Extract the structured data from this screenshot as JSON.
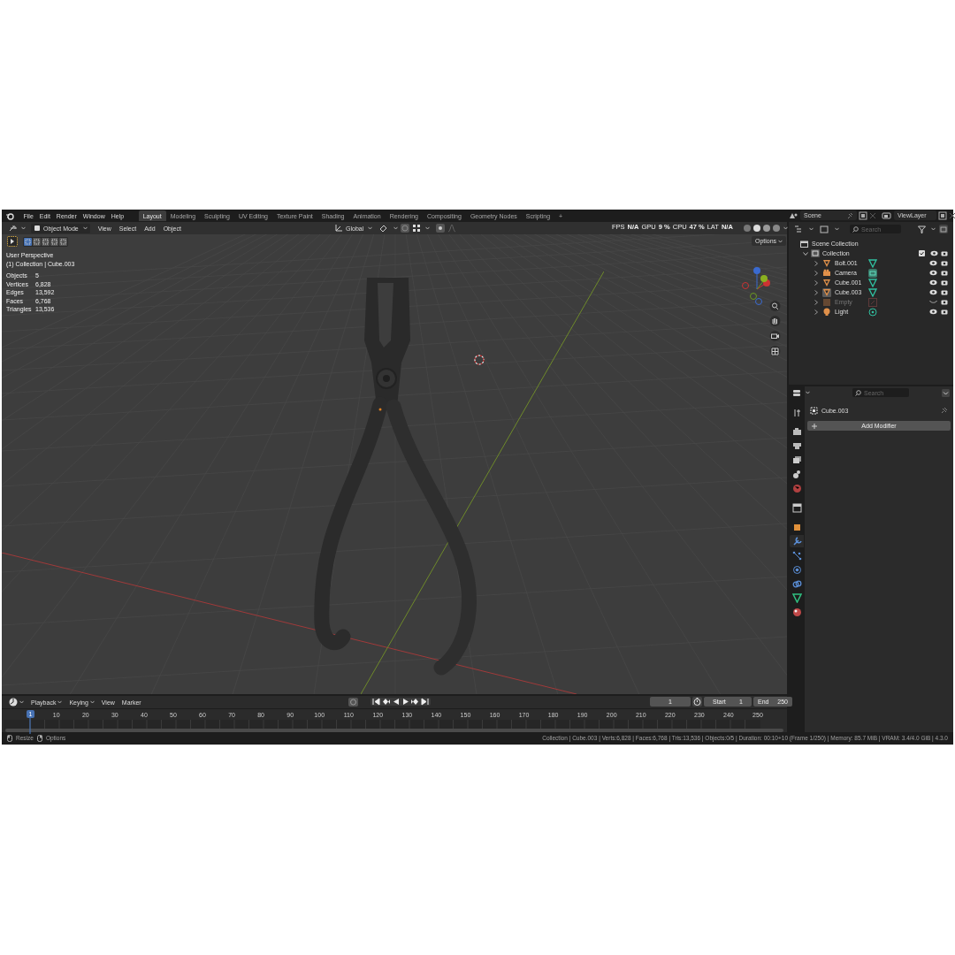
{
  "menu": [
    "File",
    "Edit",
    "Render",
    "Window",
    "Help"
  ],
  "workspace_tabs": [
    {
      "label": "Layout",
      "selected": true
    },
    {
      "label": "Modeling",
      "selected": false
    },
    {
      "label": "Sculpting",
      "selected": false
    },
    {
      "label": "UV Editing",
      "selected": false
    },
    {
      "label": "Texture Paint",
      "selected": false
    },
    {
      "label": "Shading",
      "selected": false
    },
    {
      "label": "Animation",
      "selected": false
    },
    {
      "label": "Rendering",
      "selected": false
    },
    {
      "label": "Compositing",
      "selected": false
    },
    {
      "label": "Geometry Nodes",
      "selected": false
    },
    {
      "label": "Scripting",
      "selected": false
    },
    {
      "label": "+",
      "selected": false
    }
  ],
  "scene": "Scene",
  "view_layer": "ViewLayer",
  "viewport_header": {
    "mode": "Object Mode",
    "menus": [
      "View",
      "Select",
      "Add",
      "Object"
    ],
    "orientation": "Global",
    "options": "Options"
  },
  "performance": [
    {
      "label": "FPS",
      "value": "N/A"
    },
    {
      "label": "GPU",
      "value": "9 %"
    },
    {
      "label": "CPU",
      "value": "47 %"
    },
    {
      "label": "LAT",
      "value": "N/A"
    }
  ],
  "viewport_info": {
    "view": "User Perspective",
    "context": "(1) Collection | Cube.003",
    "stats": [
      {
        "label": "Objects",
        "value": "5"
      },
      {
        "label": "Vertices",
        "value": "6,828"
      },
      {
        "label": "Edges",
        "value": "13,592"
      },
      {
        "label": "Faces",
        "value": "6,768"
      },
      {
        "label": "Triangles",
        "value": "13,536"
      }
    ]
  },
  "outliner": {
    "search_placeholder": "Search",
    "root": "Scene Collection",
    "collection": {
      "name": "Collection",
      "expanded": true,
      "checked": true
    },
    "items": [
      {
        "name": "Bolt.001",
        "kind": "mesh",
        "active": false,
        "visible": true
      },
      {
        "name": "Camera",
        "kind": "camera",
        "active": false,
        "visible": true
      },
      {
        "name": "Cube.001",
        "kind": "mesh",
        "active": false,
        "visible": true
      },
      {
        "name": "Cube.003",
        "kind": "mesh",
        "active": true,
        "visible": true
      },
      {
        "name": "Empty",
        "kind": "empty",
        "active": false,
        "visible": false
      },
      {
        "name": "Light",
        "kind": "light",
        "active": false,
        "visible": true
      }
    ]
  },
  "properties": {
    "search_placeholder": "Search",
    "object": "Cube.003",
    "add_button": "Add Modifier",
    "tabs": [
      {
        "kind": "tool",
        "selected": false
      },
      {
        "kind": "render",
        "selected": false
      },
      {
        "kind": "output",
        "selected": false
      },
      {
        "kind": "view_layer",
        "selected": false
      },
      {
        "kind": "scene",
        "selected": false
      },
      {
        "kind": "world",
        "selected": false
      },
      {
        "kind": "collection",
        "selected": false
      },
      {
        "kind": "object",
        "selected": false
      },
      {
        "kind": "modifiers",
        "selected": true
      },
      {
        "kind": "particles",
        "selected": false
      },
      {
        "kind": "physics",
        "selected": false
      },
      {
        "kind": "constraints",
        "selected": false
      },
      {
        "kind": "data",
        "selected": false
      },
      {
        "kind": "material",
        "selected": false
      }
    ]
  },
  "timeline": {
    "menus": [
      "Playback",
      "Keying",
      "View",
      "Marker"
    ],
    "current_frame": "1",
    "start_label": "Start",
    "start": "1",
    "end_label": "End",
    "end": "250",
    "playhead": "1",
    "ruler": [
      "10",
      "20",
      "30",
      "40",
      "50",
      "60",
      "70",
      "80",
      "90",
      "100",
      "110",
      "120",
      "130",
      "140",
      "150",
      "160",
      "170",
      "180",
      "190",
      "200",
      "210",
      "220",
      "230",
      "240",
      "250"
    ]
  },
  "status_bar": {
    "hints": [
      "Resize",
      "Options"
    ],
    "info": "Collection | Cube.003 | Verts:6,828 | Faces:6,768 | Tris:13,536 | Objects:0/5 | Duration: 00:10+10 (Frame 1/250) | Memory: 85.7 MiB | VRAM: 3.4/4.0 GiB | 4.3.0"
  }
}
